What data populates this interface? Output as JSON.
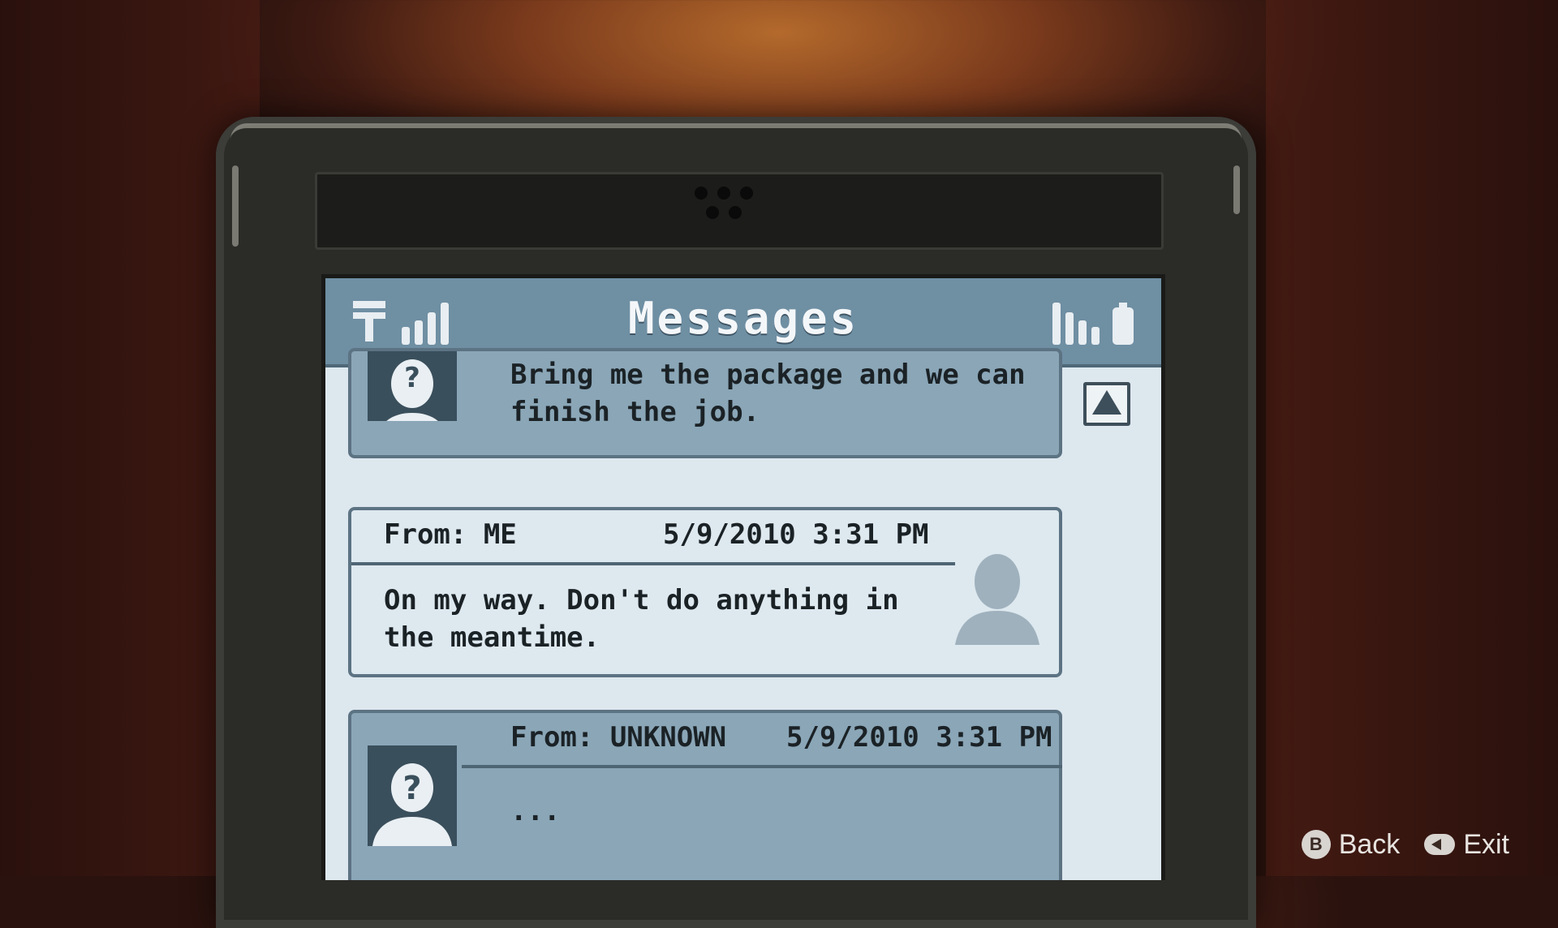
{
  "screen": {
    "title": "Messages",
    "status_icons": [
      "carrier-t-icon",
      "signal-bars-icon",
      "battery-meter-icon"
    ]
  },
  "messages": [
    {
      "type": "incoming",
      "text": "Bring me the package and we can\nfinish the job.",
      "avatar": "unknown-contact-icon"
    },
    {
      "type": "outgoing",
      "from": "From: ME",
      "timestamp": "5/9/2010 3:31 PM",
      "text": "On my way. Don't do anything in\nthe meantime.",
      "avatar": "me-contact-icon"
    },
    {
      "type": "incoming",
      "from": "From: UNKNOWN",
      "timestamp": "5/9/2010 3:31 PM",
      "text": "...",
      "avatar": "unknown-contact-icon"
    }
  ],
  "controls": {
    "back_button": "B",
    "back_label": "Back",
    "exit_label": "Exit"
  },
  "colors": {
    "screen_header": "#6f8fa3",
    "incoming_bubble": "#8aa6b7",
    "outgoing_bubble": "#dde8ef",
    "screen_background": "#dde7ee"
  }
}
